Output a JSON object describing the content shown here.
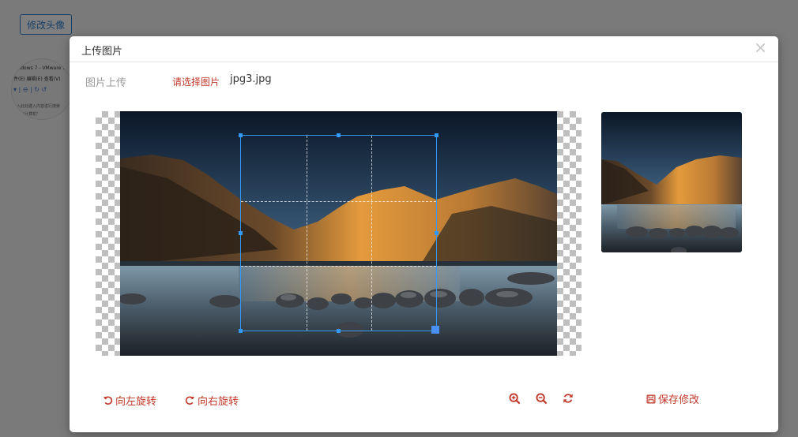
{
  "background": {
    "edit_avatar_label": "修改头像",
    "thumb_lines": [
      "Jindows 7 - VMware Wor",
      "件(E)  编辑(E)  查看(V)",
      "▾ | ⊖ | ↻ ↺",
      "入此处键入内容进行搜索",
      "\"计算机\""
    ]
  },
  "modal": {
    "title": "上传图片",
    "close_glyph": "×",
    "upload_label": "图片上传",
    "choose_label": "请选择图片",
    "file_name": "jpg3.jpg"
  },
  "toolbar": {
    "rotate_left": "向左旋转",
    "rotate_right": "向右旋转",
    "zoom_in_icon": "zoom-in-icon",
    "zoom_out_icon": "zoom-out-icon",
    "reset_icon": "refresh-icon",
    "save": "保存修改"
  },
  "colors": {
    "accent_red": "#c0392b",
    "crop_blue": "#3399ff",
    "button_blue": "#2f7fd1"
  }
}
